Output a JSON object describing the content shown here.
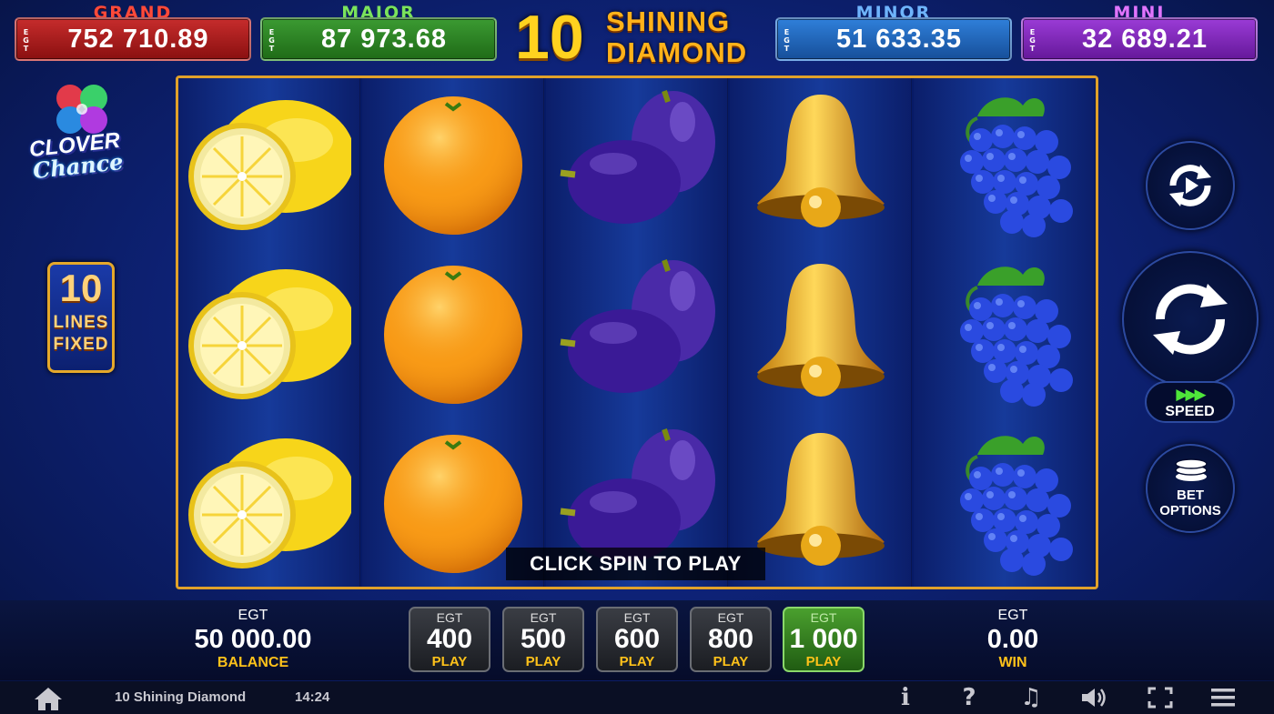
{
  "jackpots": [
    {
      "title": "GRAND",
      "currency": "EGT",
      "value": "752 710.89"
    },
    {
      "title": "MAJOR",
      "currency": "EGT",
      "value": "87 973.68"
    },
    {
      "title": "MINOR",
      "currency": "EGT",
      "value": "51 633.35"
    },
    {
      "title": "MINI",
      "currency": "EGT",
      "value": "32 689.21"
    }
  ],
  "logo": {
    "number": "10",
    "word1": "SHINING",
    "word2": "DIAMOND"
  },
  "clover": {
    "line1": "CLOVER",
    "line2": "Chance"
  },
  "lines_badge": {
    "number": "10",
    "line1": "LINES",
    "line2": "FIXED"
  },
  "reels": [
    [
      "lemon",
      "lemon",
      "lemon"
    ],
    [
      "orange",
      "orange",
      "orange"
    ],
    [
      "plum",
      "plum",
      "plum"
    ],
    [
      "bell",
      "bell",
      "bell"
    ],
    [
      "grapes",
      "grapes",
      "grapes"
    ]
  ],
  "banner": "CLICK SPIN TO PLAY",
  "controls": {
    "speed_label": "SPEED",
    "bet_options_line1": "BET",
    "bet_options_line2": "OPTIONS"
  },
  "balance": {
    "currency": "EGT",
    "value": "50 000.00",
    "label": "BALANCE"
  },
  "win": {
    "currency": "EGT",
    "value": "0.00",
    "label": "WIN"
  },
  "bets": [
    {
      "currency": "EGT",
      "value": "400",
      "label": "PLAY",
      "active": false
    },
    {
      "currency": "EGT",
      "value": "500",
      "label": "PLAY",
      "active": false
    },
    {
      "currency": "EGT",
      "value": "600",
      "label": "PLAY",
      "active": false
    },
    {
      "currency": "EGT",
      "value": "800",
      "label": "PLAY",
      "active": false
    },
    {
      "currency": "EGT",
      "value": "1 000",
      "label": "PLAY",
      "active": true
    }
  ],
  "status": {
    "game_name": "10 Shining Diamond",
    "clock": "14:24"
  },
  "icons": [
    "home-icon",
    "info-icon",
    "help-icon",
    "music-icon",
    "volume-icon",
    "fullscreen-icon",
    "menu-icon"
  ],
  "colors": {
    "reel_frame": "#e1a12a",
    "active_bet": "#4aa02e",
    "label_gold": "#ffc21a"
  }
}
